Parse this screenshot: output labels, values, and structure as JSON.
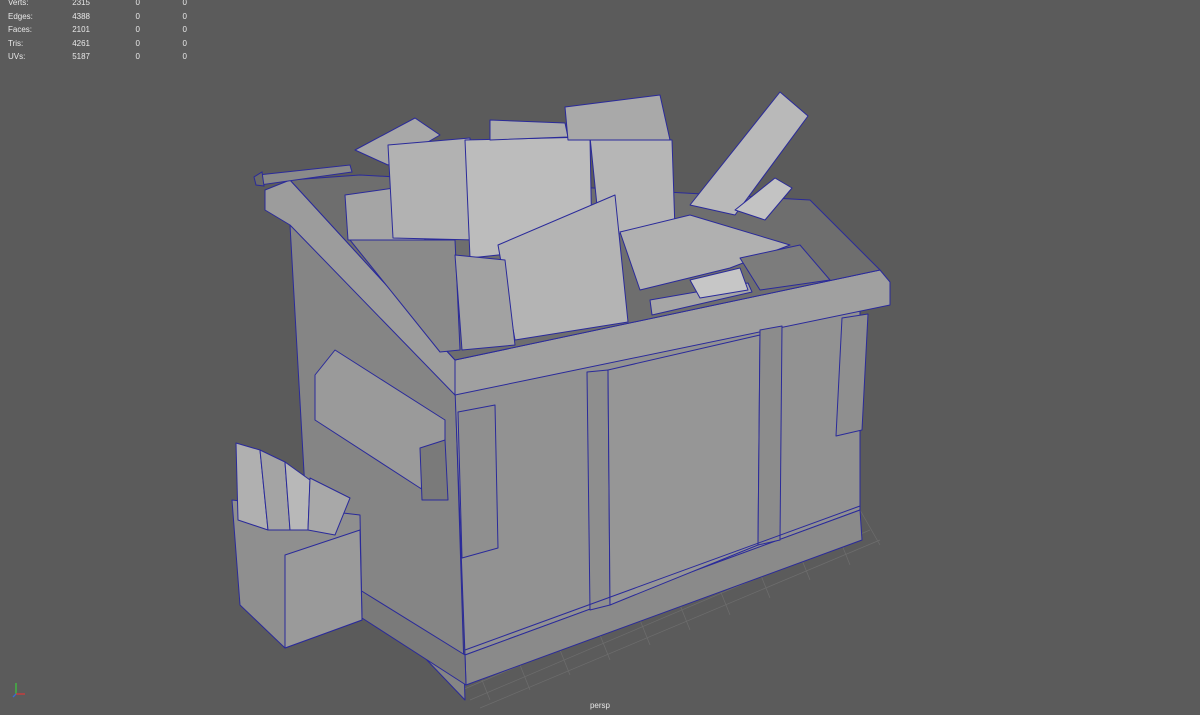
{
  "hud": {
    "rows": [
      {
        "label": "Verts:",
        "values": [
          "2315",
          "0",
          "0"
        ]
      },
      {
        "label": "Edges:",
        "values": [
          "4388",
          "0",
          "0"
        ]
      },
      {
        "label": "Faces:",
        "values": [
          "2101",
          "0",
          "0"
        ]
      },
      {
        "label": "Tris:",
        "values": [
          "4261",
          "0",
          "0"
        ]
      },
      {
        "label": "UVs:",
        "values": [
          "5187",
          "0",
          "0"
        ]
      }
    ]
  },
  "viewport": {
    "camera": "persp",
    "background_color": "#5b5b5b",
    "wire_color": "#2a2a9a",
    "shaded_color": "#8c8c8c"
  },
  "icons": {
    "axis": "view-axis-gizmo-icon"
  }
}
